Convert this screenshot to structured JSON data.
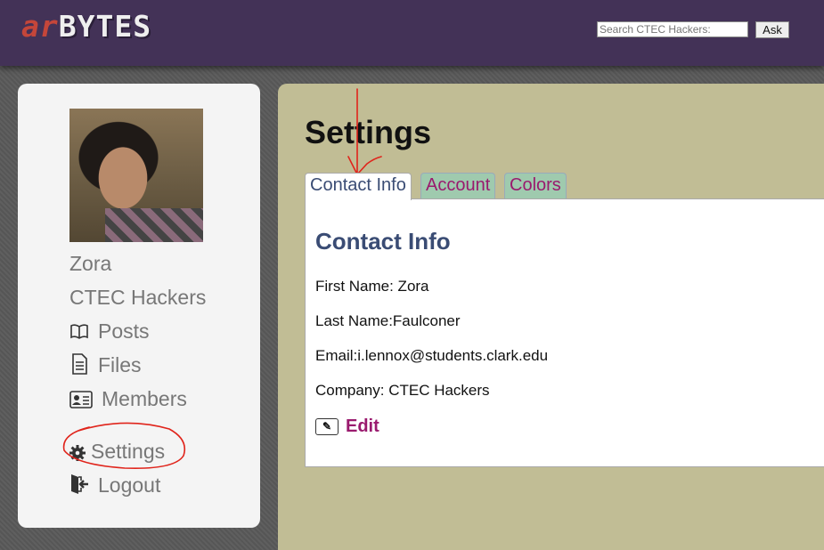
{
  "header": {
    "logo_prefix": "ar",
    "logo_main": "BYTES",
    "search_placeholder": "Search CTEC Hackers:",
    "ask_label": "Ask"
  },
  "sidebar": {
    "user_name": "Zora",
    "org_name": "CTEC Hackers",
    "items": [
      {
        "label": "Posts",
        "icon": "book-icon"
      },
      {
        "label": "Files",
        "icon": "document-icon"
      },
      {
        "label": "Members",
        "icon": "id-card-icon"
      },
      {
        "label": "Settings",
        "icon": "gear-icon"
      },
      {
        "label": "Logout",
        "icon": "logout-icon"
      }
    ]
  },
  "main": {
    "title": "Settings",
    "tabs": [
      {
        "label": "Contact Info",
        "active": true
      },
      {
        "label": "Account",
        "active": false
      },
      {
        "label": "Colors",
        "active": false
      }
    ],
    "section_title": "Contact Info",
    "fields": {
      "first_name": "First Name: Zora",
      "last_name": "Last Name:Faulconer",
      "email": "Email:i.lennox@students.clark.edu",
      "company": "Company: CTEC Hackers"
    },
    "edit_label": "Edit"
  },
  "colors": {
    "header_bg": "#433257",
    "logo_accent": "#c4463a",
    "panel_bg": "#c1bd95",
    "tab_inactive_bg": "#9fcaae",
    "link_color": "#9a1a6e",
    "heading_color": "#3a4c74",
    "annotation": "#e0241b"
  }
}
